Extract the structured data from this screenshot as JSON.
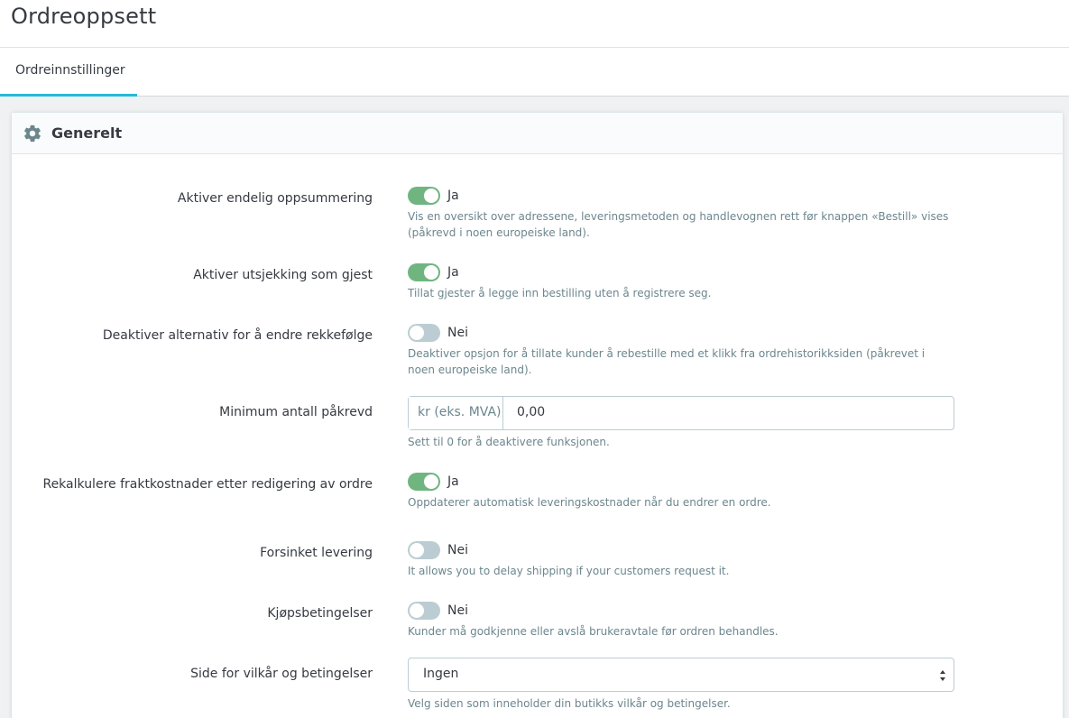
{
  "header": {
    "title": "Ordreoppsett"
  },
  "tabs": [
    {
      "label": "Ordreinnstillinger"
    }
  ],
  "panel": {
    "title": "Generelt",
    "icon": "gear-icon",
    "fields": [
      {
        "label": "Aktiver endelig oppsummering",
        "type": "switch",
        "on": true,
        "value_text": "Ja",
        "help": "Vis en oversikt over adressene, leveringsmetoden og handlevognen rett før knappen «Bestill» vises (påkrevd i noen europeiske land)."
      },
      {
        "label": "Aktiver utsjekking som gjest",
        "type": "switch",
        "on": true,
        "value_text": "Ja",
        "help": "Tillat gjester å legge inn bestilling uten å registrere seg."
      },
      {
        "label": "Deaktiver alternativ for å endre rekkefølge",
        "type": "switch",
        "on": false,
        "value_text": "Nei",
        "help": "Deaktiver opsjon for å tillate kunder å rebestille med et klikk fra ordrehistorikksiden (påkrevet i noen europeiske land)."
      },
      {
        "label": "Minimum antall påkrevd",
        "type": "input",
        "addon": "kr (eks. MVA)",
        "value": "0,00",
        "help": "Sett til 0 for å deaktivere funksjonen."
      },
      {
        "label": "Rekalkulere fraktkostnader etter redigering av ordre",
        "type": "switch",
        "on": true,
        "value_text": "Ja",
        "help": "Oppdaterer automatisk leveringskostnader når du endrer en ordre."
      },
      {
        "label": "Forsinket levering",
        "type": "switch",
        "on": false,
        "value_text": "Nei",
        "help": "It allows you to delay shipping if your customers request it."
      },
      {
        "label": "Kjøpsbetingelser",
        "type": "switch",
        "on": false,
        "value_text": "Nei",
        "help": "Kunder må godkjenne eller avslå brukeravtale før ordren behandles."
      },
      {
        "label": "Side for vilkår og betingelser",
        "type": "select",
        "value": "Ingen",
        "help": "Velg siden som inneholder din butikks vilkår og betingelser."
      }
    ]
  },
  "colors": {
    "switch_on": "#70b580",
    "switch_off": "#bbcdd2",
    "tab_accent": "#25b9d7"
  }
}
